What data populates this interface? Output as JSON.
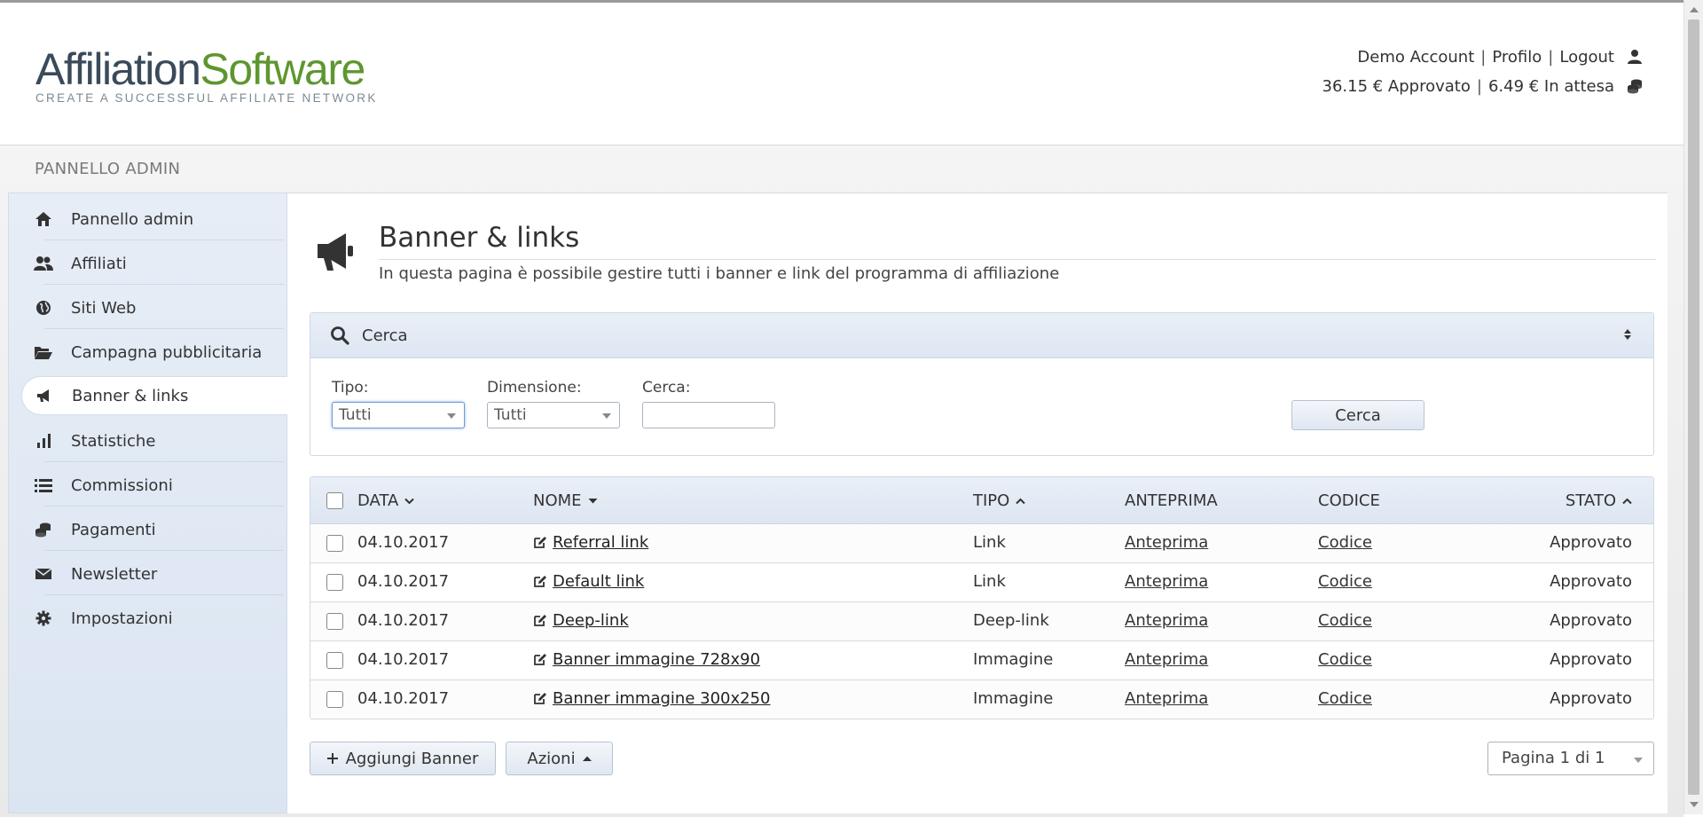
{
  "header": {
    "logo": {
      "part1": "Affiliation",
      "part2": "Software",
      "tagline": "CREATE A SUCCESSFUL AFFILIATE NETWORK"
    },
    "account": {
      "demo": "Demo Account",
      "profile": "Profilo",
      "logout": "Logout",
      "separator": "|",
      "icon": "user-icon"
    },
    "balance": {
      "approved": "36.15 € Approvato",
      "pending": "6.49 € In attesa",
      "separator": "|",
      "icon": "coins-icon"
    }
  },
  "panel": {
    "title": "PANNELLO ADMIN"
  },
  "sidebar": {
    "items": [
      {
        "label": "Pannello admin",
        "icon": "home-icon"
      },
      {
        "label": "Affiliati",
        "icon": "users-icon"
      },
      {
        "label": "Siti Web",
        "icon": "globe-icon"
      },
      {
        "label": "Campagna pubblicitaria",
        "icon": "folder-open-icon"
      },
      {
        "label": "Banner & links",
        "icon": "bullhorn-icon",
        "active": true
      },
      {
        "label": "Statistiche",
        "icon": "bar-chart-icon"
      },
      {
        "label": "Commissioni",
        "icon": "list-icon"
      },
      {
        "label": "Pagamenti",
        "icon": "coins-icon"
      },
      {
        "label": "Newsletter",
        "icon": "envelope-icon"
      },
      {
        "label": "Impostazioni",
        "icon": "gear-icon"
      }
    ]
  },
  "page": {
    "title": "Banner & links",
    "subtitle": "In questa pagina è possibile gestire tutti i banner e link del programma di affiliazione",
    "icon": "bullhorn-icon"
  },
  "search": {
    "title": "Cerca",
    "filters": {
      "tipo": {
        "label": "Tipo:",
        "value": "Tutti"
      },
      "dimensione": {
        "label": "Dimensione:",
        "value": "Tutti"
      },
      "cerca": {
        "label": "Cerca:",
        "value": ""
      }
    },
    "button": "Cerca"
  },
  "table": {
    "columns": {
      "data": "DATA",
      "nome": "NOME",
      "tipo": "TIPO",
      "anteprima": "ANTEPRIMA",
      "codice": "CODICE",
      "stato": "STATO"
    },
    "rows": [
      {
        "data": "04.10.2017",
        "nome": "Referral link",
        "tipo": "Link",
        "anteprima": "Anteprima",
        "codice": "Codice",
        "stato": "Approvato"
      },
      {
        "data": "04.10.2017",
        "nome": "Default link",
        "tipo": "Link",
        "anteprima": "Anteprima",
        "codice": "Codice",
        "stato": "Approvato"
      },
      {
        "data": "04.10.2017",
        "nome": "Deep-link",
        "tipo": "Deep-link",
        "anteprima": "Anteprima",
        "codice": "Codice",
        "stato": "Approvato"
      },
      {
        "data": "04.10.2017",
        "nome": "Banner immagine 728x90",
        "tipo": "Immagine",
        "anteprima": "Anteprima",
        "codice": "Codice",
        "stato": "Approvato"
      },
      {
        "data": "04.10.2017",
        "nome": "Banner immagine 300x250",
        "tipo": "Immagine",
        "anteprima": "Anteprima",
        "codice": "Codice",
        "stato": "Approvato"
      }
    ]
  },
  "footer": {
    "add_button": "Aggiungi Banner",
    "actions_button": "Azioni",
    "pager": "Pagina 1 di 1"
  }
}
